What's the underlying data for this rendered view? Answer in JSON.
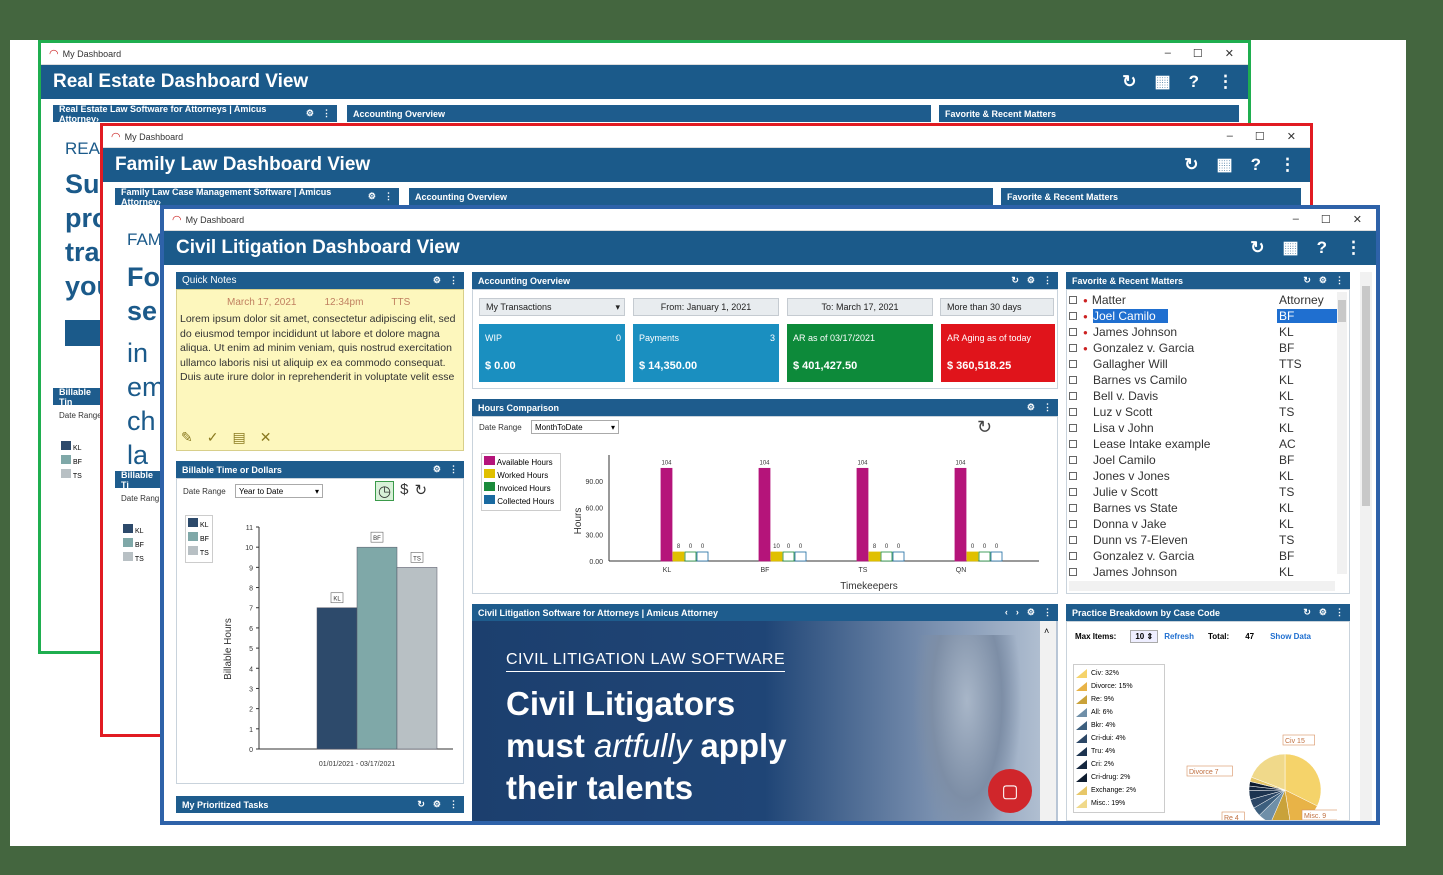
{
  "win1": {
    "tab": "My Dashboard",
    "title": "Real Estate Dashboard View",
    "bars": [
      "Real Estate Law Software for Attorneys | Amicus Attorney›",
      "Accounting Overview",
      "Favorite & Recent Matters"
    ],
    "big_lines": [
      "REAL",
      "Su",
      "pro",
      "tra",
      "you"
    ],
    "billable": "Billable Tin",
    "date_range": "Date Range",
    "legend": [
      "KL",
      "BF",
      "TS"
    ]
  },
  "win2": {
    "tab": "My Dashboard",
    "title": "Family Law Dashboard View",
    "bars": [
      "Family Law Case Management Software | Amicus Attorney›",
      "Accounting Overview",
      "Favorite & Recent Matters"
    ],
    "big_lines": [
      "FAM",
      "Fo",
      "se",
      "in",
      "em",
      "ch",
      "la"
    ],
    "billable": "Billable Ti",
    "date_range": "Date Rang",
    "legend": [
      "KL",
      "BF",
      "TS"
    ]
  },
  "win3": {
    "tab": "My Dashboard",
    "title": "Civil Litigation Dashboard View",
    "quick_notes": {
      "title": "Quick Notes",
      "date": "March 17, 2021",
      "time": "12:34pm",
      "user": "TTS",
      "text": "Lorem ipsum dolor sit amet, consectetur adipiscing elit, sed do eiusmod tempor incididunt ut labore et dolore magna aliqua. Ut enim ad minim veniam, quis nostrud exercitation ullamco laboris nisi ut aliquip ex ea commodo consequat. Duis aute irure dolor in reprehenderit in voluptate velit esse"
    },
    "billable": {
      "title": "Billable Time or Dollars",
      "date_range": "Date Range",
      "range_value": "Year to Date",
      "legend": [
        "KL",
        "BF",
        "TS"
      ],
      "ylabel": "Billable Hours",
      "xlabel": "01/01/2021 - 03/17/2021"
    },
    "accounting": {
      "title": "Accounting Overview",
      "filters": [
        "My Transactions",
        "From: January 1, 2021",
        "To: March 17, 2021",
        "More than 30 days"
      ],
      "tiles": [
        {
          "label": "WIP",
          "num": "0",
          "value": "$ 0.00",
          "color": "#1a8fc0"
        },
        {
          "label": "Payments",
          "num": "3",
          "value": "$ 14,350.00",
          "color": "#1a8fc0"
        },
        {
          "label": "AR as of 03/17/2021",
          "num": "",
          "value": "$ 401,427.50",
          "color": "#0d8a3a"
        },
        {
          "label": "AR Aging as of today",
          "num": "",
          "value": "$ 360,518.25",
          "color": "#e0141b"
        }
      ]
    },
    "hours": {
      "title": "Hours Comparison",
      "date_range": "Date Range",
      "range_value": "MonthToDate",
      "legend": [
        "Available Hours",
        "Worked Hours",
        "Invoiced Hours",
        "Collected Hours"
      ],
      "ylabel": "Hours",
      "xlabel": "Timekeepers"
    },
    "favorites": {
      "title": "Favorite & Recent Matters",
      "col1": "Matter",
      "col2": "Attorney",
      "rows": [
        [
          "Joel Camilo",
          "BF"
        ],
        [
          "James Johnson",
          "KL"
        ],
        [
          "Gonzalez v. Garcia",
          "BF"
        ],
        [
          "Gallagher Will",
          "TTS"
        ],
        [
          "Barnes vs Camilo",
          "KL"
        ],
        [
          "Bell v. Davis",
          "KL"
        ],
        [
          "Luz v Scott",
          "TS"
        ],
        [
          "Lisa v John",
          "KL"
        ],
        [
          "Lease Intake example",
          "AC"
        ],
        [
          "Joel Camilo",
          "BF"
        ],
        [
          "Jones v Jones",
          "KL"
        ],
        [
          "Julie v Scott",
          "TS"
        ],
        [
          "Barnes vs State",
          "KL"
        ],
        [
          "Donna v Jake",
          "KL"
        ],
        [
          "Dunn vs 7-Eleven",
          "TS"
        ],
        [
          "Gonzalez v. Garcia",
          "BF"
        ],
        [
          "James Johnson",
          "KL"
        ]
      ]
    },
    "promo": {
      "bar": "Civil Litigation Software for Attorneys | Amicus Attorney",
      "kicker": "CIVIL LITIGATION LAW SOFTWARE",
      "line1": "Civil Litigators",
      "line2a": "must ",
      "line2b": "artfully",
      "line2c": " apply",
      "line3": "their talents"
    },
    "practice": {
      "title": "Practice Breakdown by Case Code",
      "max_label": "Max Items:",
      "max_value": "10",
      "refresh": "Refresh",
      "total_label": "Total:",
      "total_value": "47",
      "show": "Show Data",
      "legend": [
        "Civ: 32%",
        "Divorce: 15%",
        "Re: 9%",
        "All: 6%",
        "Bkr: 4%",
        "Cri-dui: 4%",
        "Tru: 4%",
        "Cri: 2%",
        "Cri-drug: 2%",
        "Exchange: 2%",
        "Misc.: 19%"
      ],
      "callouts": [
        "Civ 15",
        "Divorce 7",
        "Re 4",
        "Misc. 9"
      ]
    },
    "tasks": {
      "title": "My Prioritized Tasks"
    }
  },
  "chart_data": [
    {
      "type": "bar",
      "title": "Billable Time or Dollars",
      "categories": [
        "KL",
        "BF",
        "TS"
      ],
      "values": [
        7,
        10,
        9
      ],
      "ylabel": "Billable Hours",
      "xlabel": "01/01/2021 - 03/17/2021",
      "ylim": [
        0,
        11
      ],
      "yticks": [
        "0",
        "1",
        "2",
        "3",
        "4",
        "5",
        "6",
        "7",
        "8",
        "9",
        "10",
        "11"
      ],
      "colors": [
        "#2d4a6b",
        "#7fa8a8",
        "#b8c0c4"
      ]
    },
    {
      "type": "bar",
      "title": "Hours Comparison",
      "categories": [
        "KL",
        "BF",
        "TS",
        "QN"
      ],
      "series": [
        {
          "name": "Available Hours",
          "values": [
            104,
            104,
            104,
            104
          ],
          "color": "#b5147a"
        },
        {
          "name": "Worked Hours",
          "values": [
            8,
            10,
            8,
            0
          ],
          "color": "#e0c000"
        },
        {
          "name": "Invoiced Hours",
          "values": [
            0,
            0,
            0,
            0
          ],
          "color": "#1a8a3a"
        },
        {
          "name": "Collected Hours",
          "values": [
            0,
            0,
            0,
            0
          ],
          "color": "#1a6aa0"
        }
      ],
      "ylabel": "Hours",
      "xlabel": "Timekeepers",
      "ylim": [
        0,
        110
      ],
      "yticks": [
        "0.00",
        "30.00",
        "60.00",
        "90.00"
      ]
    }
  ]
}
